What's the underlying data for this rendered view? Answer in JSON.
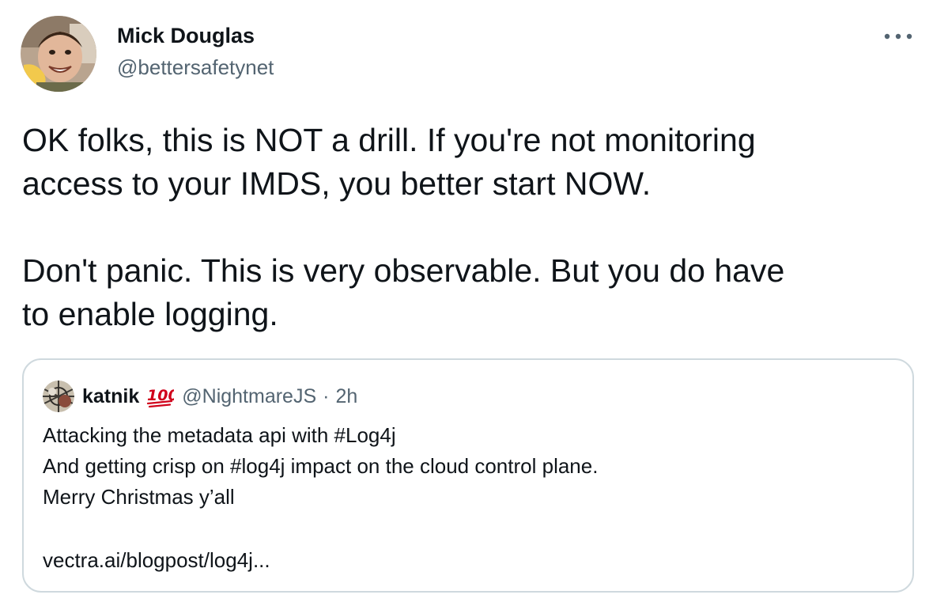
{
  "tweet": {
    "author": {
      "name": "Mick Douglas",
      "handle": "@bettersafetynet"
    },
    "more_icon": "more-horizontal-icon",
    "text": {
      "line1": "OK folks, this is NOT a drill. If you're not monitoring",
      "line2": "access to your IMDS, you better start NOW.",
      "line3": "Don't panic. This is very observable. But you do have",
      "line4": "to enable logging."
    }
  },
  "quoted_tweet": {
    "author": {
      "name": "katnik",
      "badge_icon": "hundred-points-icon",
      "handle": "@NightmareJS",
      "separator": "·",
      "time": "2h"
    },
    "text": {
      "line1": "Attacking the metadata api with #Log4j",
      "line2": "And getting crisp on #log4j impact on the cloud control plane.",
      "line3": "Merry Christmas y’all",
      "link": "vectra.ai/blogpost/log4j..."
    }
  },
  "colors": {
    "text_primary": "#0f1419",
    "text_secondary": "#536471",
    "border": "#cfd9de",
    "hundred_red": "#d0021b"
  }
}
